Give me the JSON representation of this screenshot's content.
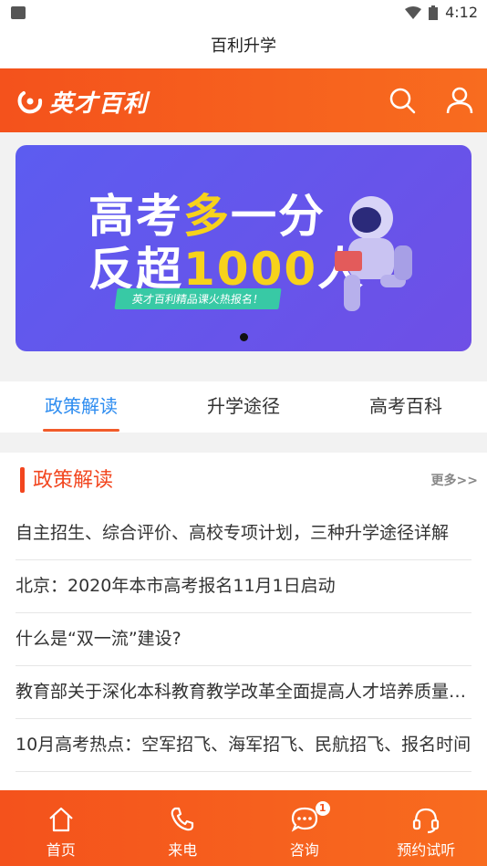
{
  "status_bar": {
    "time": "4:12"
  },
  "title_bar": {
    "title": "百利升学"
  },
  "header": {
    "logo_text": "英才百利",
    "accent_color": "#f4521c",
    "icons": [
      "search-icon",
      "user-icon"
    ]
  },
  "banner": {
    "line1_white": "高考",
    "line1_yellow": "多",
    "line1_white2": "一分",
    "line2_white": "反超",
    "line2_yellow": "1000",
    "line2_white2": "人",
    "pill": "英才百利精品课火热报名！"
  },
  "tabs": [
    {
      "label": "政策解读",
      "active": true
    },
    {
      "label": "升学途径",
      "active": false
    },
    {
      "label": "高考百科",
      "active": false
    }
  ],
  "news": {
    "section_title": "政策解读",
    "more_label": "更多>>",
    "items": [
      "自主招生、综合评价、高校专项计划，三种升学途径详解",
      "北京：2020年本市高考报名11月1日启动",
      "什么是“双一流”建设?",
      "教育部关于深化本科教育教学改革全面提高人才培养质量的意见",
      "10月高考热点：空军招飞、海军招飞、民航招飞、报名时间"
    ]
  },
  "tabbar": {
    "items": [
      {
        "label": "首页",
        "icon": "home-icon"
      },
      {
        "label": "来电",
        "icon": "phone-icon"
      },
      {
        "label": "咨询",
        "icon": "chat-icon",
        "badge": "1"
      },
      {
        "label": "预约试听",
        "icon": "headset-icon"
      }
    ]
  }
}
